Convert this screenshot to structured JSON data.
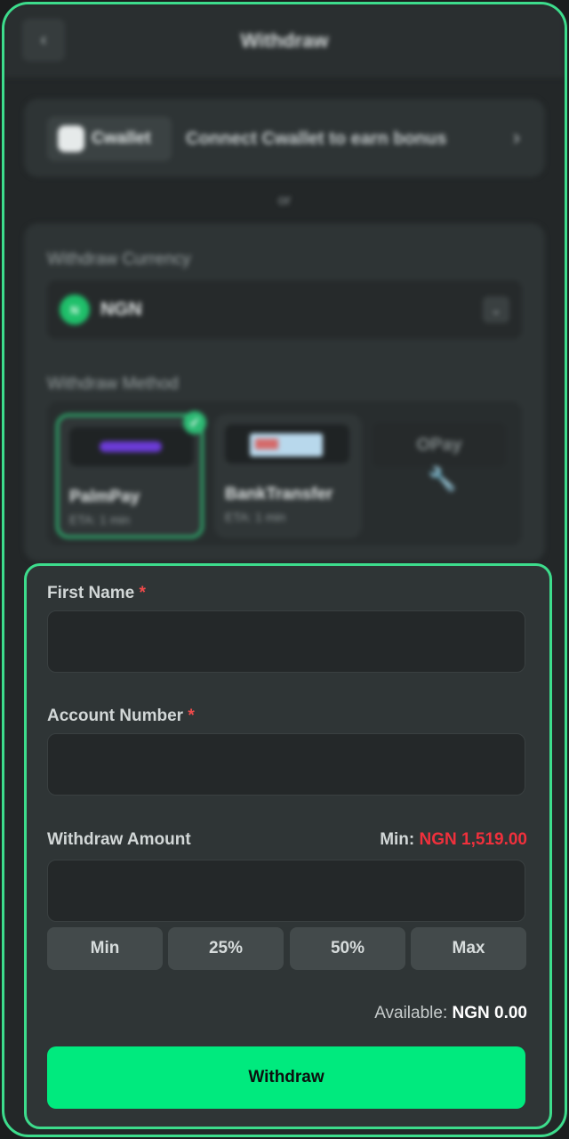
{
  "header": {
    "title": "Withdraw",
    "back_icon": "chevron-left-icon"
  },
  "cwallet": {
    "brand": "Cwallet",
    "promo": "Connect Cwallet to earn bonus",
    "chevron_icon": "chevron-right-icon"
  },
  "separator": "or",
  "currency": {
    "label": "Withdraw Currency",
    "badge": "N",
    "selected": "NGN",
    "dropdown_icon": "chevron-down-icon"
  },
  "method": {
    "label": "Withdraw Method",
    "items": [
      {
        "name": "PalmPay",
        "eta": "ETA: 1 min",
        "selected": true
      },
      {
        "name": "BankTransfer",
        "eta": "ETA: 1 min",
        "selected": false
      },
      {
        "name": "OPay",
        "eta": "",
        "selected": false,
        "status_icon": "wrench-icon"
      }
    ]
  },
  "form": {
    "first_name_label": "First Name",
    "first_name_value": "",
    "account_number_label": "Account Number",
    "account_number_value": "",
    "required_mark": "*",
    "amount_label": "Withdraw Amount",
    "amount_value": "",
    "min_label": "Min:",
    "min_value": "NGN 1,519.00",
    "quick_amounts": [
      "Min",
      "25%",
      "50%",
      "Max"
    ],
    "available_label": "Available:",
    "available_value": "NGN 0.00",
    "submit_label": "Withdraw"
  },
  "colors": {
    "accent": "#00ea7e",
    "error": "#f0303c",
    "selected_border": "#2dbb74"
  }
}
